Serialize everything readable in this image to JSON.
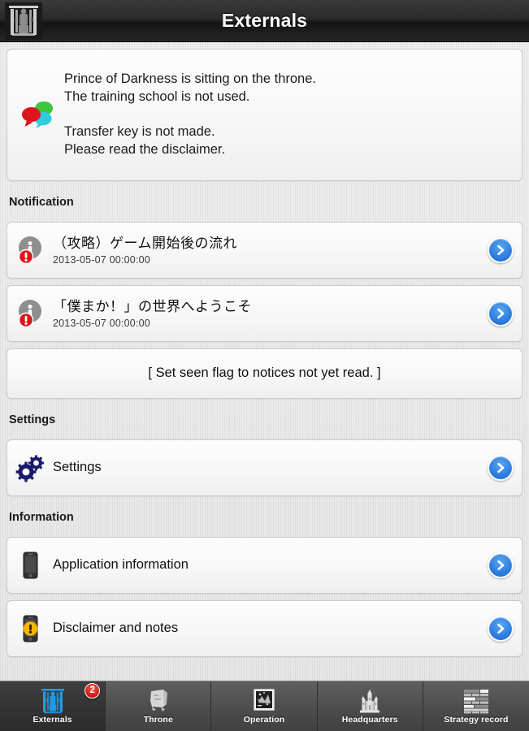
{
  "header": {
    "title": "Externals",
    "logo_icon": "throne-gate-logo-icon"
  },
  "message_panel": {
    "icon": "speech-bubbles-icon",
    "text": "Prince of Darkness is sitting on the throne.\nThe training school is not used.\n\nTransfer key is not made.\nPlease read the disclaimer."
  },
  "sections": {
    "notification": {
      "label": "Notification",
      "items": [
        {
          "icon": "info-alert-icon",
          "title": "（攻略）ゲーム開始後の流れ",
          "timestamp": "2013-05-07 00:00:00",
          "chevron": "chevron-right-icon"
        },
        {
          "icon": "info-alert-icon",
          "title": "「僕まか！」の世界へようこそ",
          "timestamp": "2013-05-07 00:00:00",
          "chevron": "chevron-right-icon"
        }
      ],
      "action": {
        "label": "[ Set seen flag to notices not yet read. ]"
      }
    },
    "settings": {
      "label": "Settings",
      "items": [
        {
          "icon": "gears-icon",
          "title": "Settings",
          "chevron": "chevron-right-icon"
        }
      ]
    },
    "information": {
      "label": "Information",
      "items": [
        {
          "icon": "phone-icon",
          "title": "Application information",
          "chevron": "chevron-right-icon"
        },
        {
          "icon": "phone-warning-icon",
          "title": "Disclaimer and notes",
          "chevron": "chevron-right-icon"
        }
      ]
    }
  },
  "tabbar": {
    "tabs": [
      {
        "label": "Externals",
        "icon": "gate-icon",
        "active": true,
        "badge": "2"
      },
      {
        "label": "Throne",
        "icon": "throne-chair-icon",
        "active": false,
        "badge": ""
      },
      {
        "label": "Operation",
        "icon": "map-icon",
        "active": false,
        "badge": ""
      },
      {
        "label": "Headquarters",
        "icon": "castle-icon",
        "active": false,
        "badge": ""
      },
      {
        "label": "Strategy record",
        "icon": "records-table-icon",
        "active": false,
        "badge": ""
      }
    ]
  },
  "colors": {
    "accent_blue": "#2f7fe0",
    "badge_red": "#d8211c",
    "gear_navy": "#1b1b6e",
    "warning_yellow": "#f5b800",
    "active_tab_icon": "#1e9be8",
    "header_bg": "#222222"
  }
}
